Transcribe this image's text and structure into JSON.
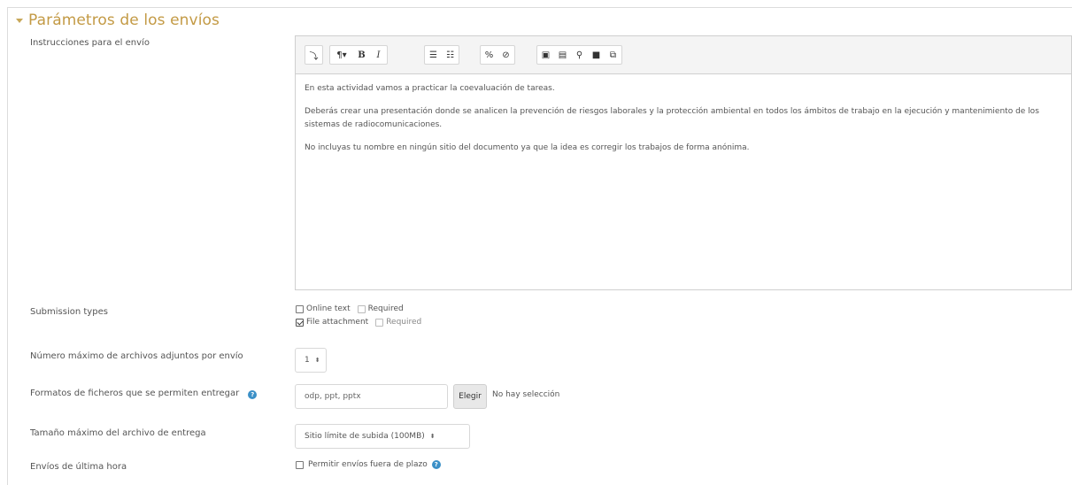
{
  "section": {
    "title": "Parámetros de los envíos"
  },
  "instructions": {
    "label": "Instrucciones para el envío",
    "toolbar": [
      {
        "icon": "collapse-toolbar-icon",
        "glyph": "⤵"
      },
      {
        "icon": "paragraph-styles-icon",
        "glyph": "¶▾"
      },
      {
        "icon": "bold-icon",
        "glyph": "B"
      },
      {
        "icon": "italic-icon",
        "glyph": "I"
      },
      {
        "icon": "unordered-list-icon",
        "glyph": "☰"
      },
      {
        "icon": "ordered-list-icon",
        "glyph": "☷"
      },
      {
        "icon": "link-icon",
        "glyph": "🔗"
      },
      {
        "icon": "unlink-icon",
        "glyph": "⛓"
      },
      {
        "icon": "image-icon",
        "glyph": "▣"
      },
      {
        "icon": "media-icon",
        "glyph": "▤"
      },
      {
        "icon": "record-audio-icon",
        "glyph": "🎙"
      },
      {
        "icon": "record-video-icon",
        "glyph": "■"
      },
      {
        "icon": "manage-files-icon",
        "glyph": "⧉"
      }
    ],
    "paragraphs": [
      "En esta actividad vamos a practicar la coevaluación de tareas.",
      "Deberás crear una presentación donde se analicen la prevención de riesgos laborales y la protección ambiental en todos los ámbitos de trabajo en la ejecución y mantenimiento de los sistemas de radiocomunicaciones.",
      "No incluyas tu nombre en ningún sitio del documento ya que la idea es corregir los trabajos de forma anónima."
    ]
  },
  "submission_types": {
    "label": "Submission types",
    "online_text": "Online text",
    "online_required": "Required",
    "file_attachment": "File attachment",
    "file_required": "Required"
  },
  "max_files": {
    "label": "Número máximo de archivos adjuntos por envío",
    "value": "1"
  },
  "file_types": {
    "label": "Formatos de ficheros que se permiten entregar",
    "value": "odp, ppt, pptx",
    "button": "Elegir",
    "selection": "No hay selección"
  },
  "max_size": {
    "label": "Tamaño máximo del archivo de entrega",
    "value": "Sitio límite de subida (100MB)"
  },
  "late": {
    "label": "Envíos de última hora",
    "checkbox": "Permitir envíos fuera de plazo"
  }
}
